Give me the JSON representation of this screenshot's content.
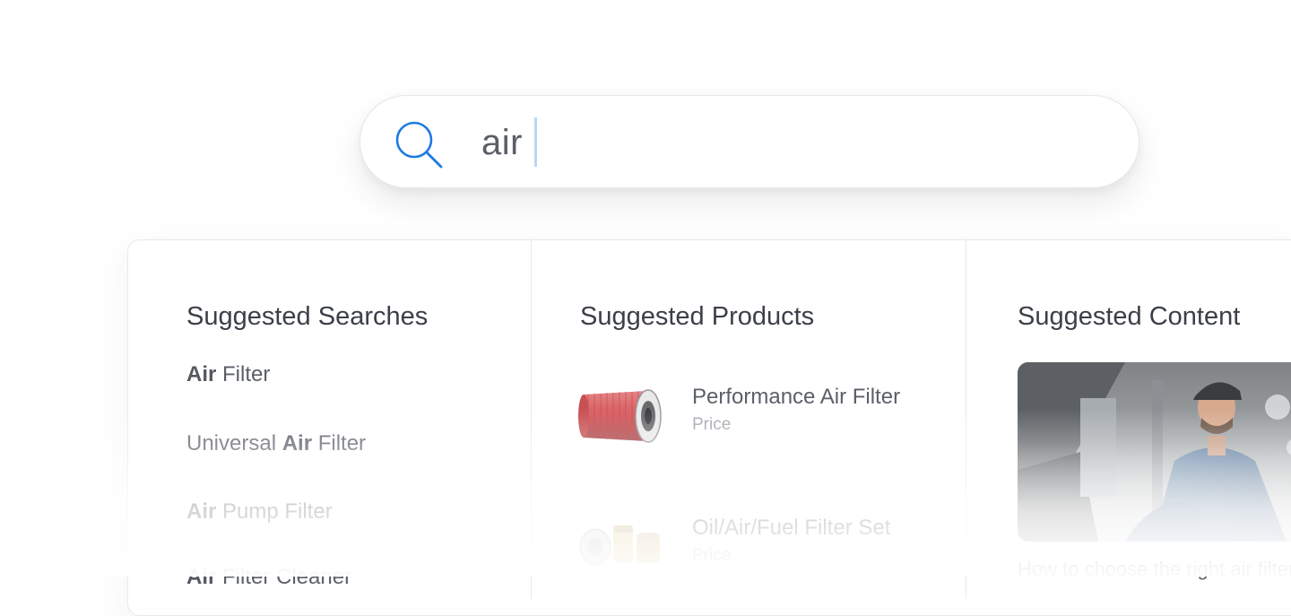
{
  "search": {
    "value": "air"
  },
  "columns": {
    "searches": {
      "title": "Suggested Searches",
      "items": [
        {
          "bold": "Air",
          "pre": "",
          "post": " Filter"
        },
        {
          "bold": "Air",
          "pre": "Universal ",
          "post": " Filter"
        },
        {
          "bold": "Air",
          "pre": "",
          "post": " Pump Filter"
        },
        {
          "bold": "Air",
          "pre": "",
          "post": " Filter Cleaner"
        }
      ]
    },
    "products": {
      "title": "Suggested Products",
      "items": [
        {
          "name": "Performance Air Filter",
          "price": "Price"
        },
        {
          "name": "Oil/Air/Fuel Filter Set",
          "price": "Price"
        }
      ]
    },
    "content": {
      "title": "Suggested Content",
      "caption": "How to choose the right air filter"
    }
  },
  "colors": {
    "accent": "#1f7ae0",
    "caret": "#bcd7f5",
    "filter_red": "#d6575a"
  }
}
